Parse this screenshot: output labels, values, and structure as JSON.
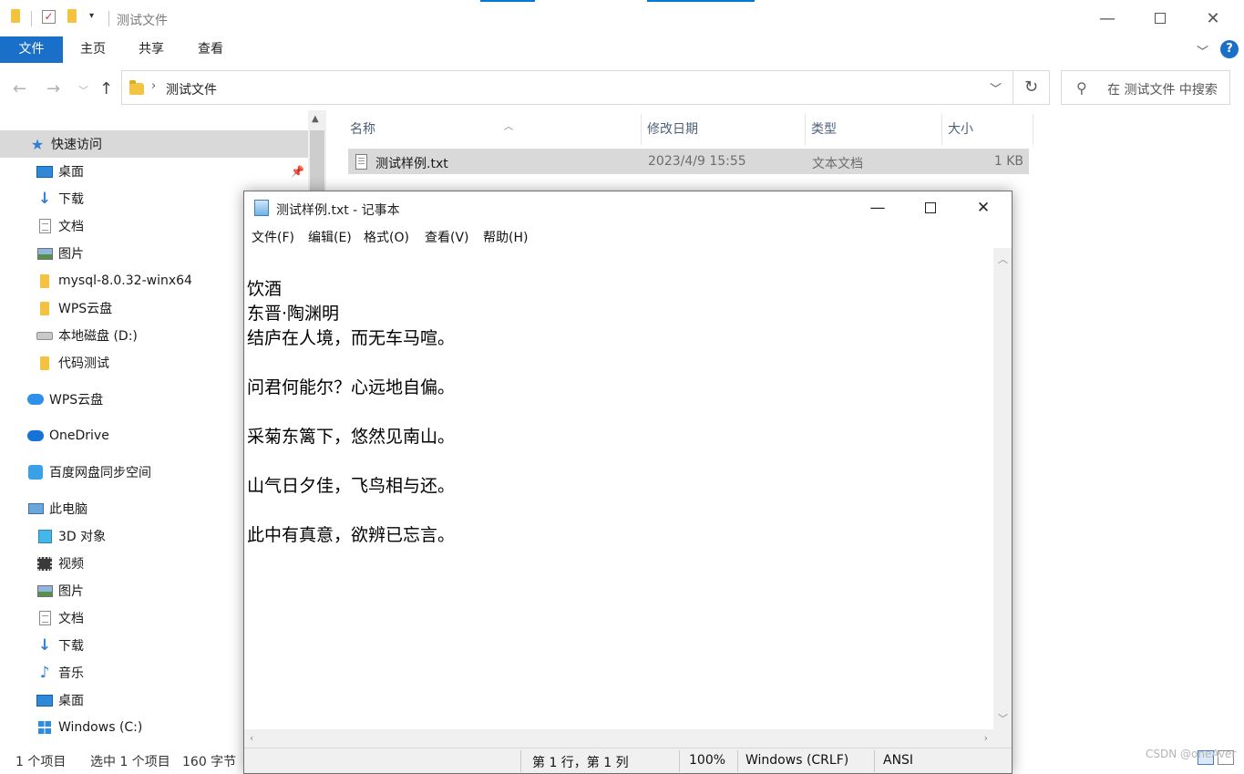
{
  "explorer": {
    "title": "测试文件",
    "ribbon_tabs": [
      "文件",
      "主页",
      "共享",
      "查看"
    ],
    "ribbon_help": "?",
    "address_path": "测试文件",
    "search_placeholder": "在 测试文件 中搜索",
    "columns": [
      "名称",
      "修改日期",
      "类型",
      "大小"
    ],
    "files": [
      {
        "name": "测试样例.txt",
        "modified": "2023/4/9 15:55",
        "type": "文本文档",
        "size": "1 KB"
      }
    ],
    "status": {
      "count": "1 个项目",
      "selected": "选中 1 个项目",
      "size": "160 字节"
    },
    "colors": {
      "accent": "#1a6fc9",
      "selected_row": "#d9d9d9"
    }
  },
  "nav_pane": {
    "items": [
      {
        "label": "快速访问",
        "icon": "star-icon"
      },
      {
        "label": "桌面",
        "icon": "desktop-icon",
        "pinned": true
      },
      {
        "label": "下载",
        "icon": "download-icon"
      },
      {
        "label": "文档",
        "icon": "document-icon"
      },
      {
        "label": "图片",
        "icon": "pictures-icon"
      },
      {
        "label": "mysql-8.0.32-winx64",
        "icon": "folder-icon"
      },
      {
        "label": "WPS云盘",
        "icon": "folder-icon"
      },
      {
        "label": "本地磁盘 (D:)",
        "icon": "drive-icon"
      },
      {
        "label": "代码测试",
        "icon": "folder-icon"
      },
      {
        "label": "WPS云盘",
        "icon": "wps-cloud-icon"
      },
      {
        "label": "OneDrive",
        "icon": "onedrive-icon"
      },
      {
        "label": "百度网盘同步空间",
        "icon": "baidu-netdisk-icon"
      },
      {
        "label": "此电脑",
        "icon": "this-pc-icon"
      },
      {
        "label": "3D 对象",
        "icon": "3d-objects-icon"
      },
      {
        "label": "视频",
        "icon": "videos-icon"
      },
      {
        "label": "图片",
        "icon": "pictures-icon"
      },
      {
        "label": "文档",
        "icon": "document-icon"
      },
      {
        "label": "下载",
        "icon": "download-icon"
      },
      {
        "label": "音乐",
        "icon": "music-icon"
      },
      {
        "label": "桌面",
        "icon": "desktop-icon"
      },
      {
        "label": "Windows (C:)",
        "icon": "windows-drive-icon"
      }
    ]
  },
  "notepad": {
    "title": "测试样例.txt - 记事本",
    "menu": [
      "文件(F)",
      "编辑(E)",
      "格式(O)",
      "查看(V)",
      "帮助(H)"
    ],
    "lines": [
      "饮酒",
      "东晋·陶渊明",
      "结庐在人境，而无车马喧。",
      "",
      "问君何能尔？心远地自偏。",
      "",
      "采菊东篱下，悠然见南山。",
      "",
      "山气日夕佳，飞鸟相与还。",
      "",
      "此中有真意，欲辨已忘言。"
    ],
    "status": {
      "position": "第 1 行，第 1 列",
      "zoom": "100%",
      "line_ending": "Windows (CRLF)",
      "encoding": "ANSI"
    }
  },
  "watermark": "CSDN @oneAver"
}
